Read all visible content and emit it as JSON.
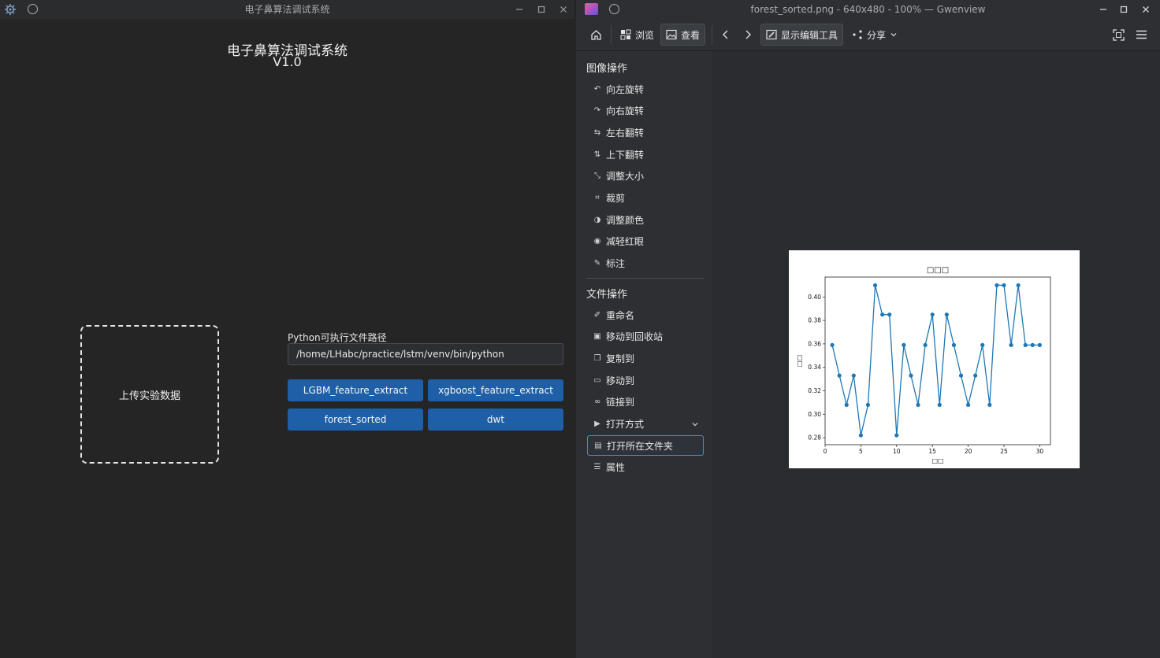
{
  "left_window": {
    "title": "电子鼻算法调试系统",
    "app_title": "电子鼻算法调试系统",
    "version": "V1.0",
    "upload_label": "上传实验数据",
    "python_path_label": "Python可执行文件路径",
    "python_path_value": "/home/LHabc/practice/lstm/venv/bin/python",
    "buttons": {
      "lgbm": "LGBM_feature_extract",
      "xgboost": "xgboost_feature_extract",
      "forest": "forest_sorted",
      "dwt": "dwt"
    }
  },
  "right_window": {
    "title": "forest_sorted.png - 640x480 - 100% — Gwenview",
    "toolbar": {
      "browse": "浏览",
      "view": "查看",
      "show_edit_tools": "显示编辑工具",
      "share": "分享"
    },
    "sidebar": {
      "image_ops_title": "图像操作",
      "image_ops": [
        {
          "label": "向左旋转",
          "icon": "rotate-left-icon"
        },
        {
          "label": "向右旋转",
          "icon": "rotate-right-icon"
        },
        {
          "label": "左右翻转",
          "icon": "flip-horizontal-icon"
        },
        {
          "label": "上下翻转",
          "icon": "flip-vertical-icon"
        },
        {
          "label": "调整大小",
          "icon": "resize-icon"
        },
        {
          "label": "裁剪",
          "icon": "crop-icon"
        },
        {
          "label": "调整颜色",
          "icon": "adjust-color-icon"
        },
        {
          "label": "减轻红眼",
          "icon": "red-eye-icon"
        },
        {
          "label": "标注",
          "icon": "annotate-icon"
        }
      ],
      "file_ops_title": "文件操作",
      "file_ops": [
        {
          "label": "重命名",
          "icon": "rename-icon"
        },
        {
          "label": "移动到回收站",
          "icon": "trash-icon"
        },
        {
          "label": "复制到",
          "icon": "copy-icon"
        },
        {
          "label": "移动到",
          "icon": "move-icon"
        },
        {
          "label": "链接到",
          "icon": "link-icon"
        },
        {
          "label": "打开方式",
          "icon": "open-with-icon"
        },
        {
          "label": "打开所在文件夹",
          "icon": "folder-icon"
        },
        {
          "label": "属性",
          "icon": "properties-icon"
        }
      ]
    }
  },
  "chart_data": {
    "type": "line",
    "title": "□□□",
    "xlabel": "□□",
    "ylabel": "□□",
    "x": [
      1,
      2,
      3,
      4,
      5,
      6,
      7,
      8,
      9,
      10,
      11,
      12,
      13,
      14,
      15,
      16,
      17,
      18,
      19,
      20,
      21,
      22,
      23,
      24,
      25,
      26,
      27,
      28,
      29,
      30
    ],
    "series": [
      {
        "values": [
          0.359,
          0.333,
          0.308,
          0.333,
          0.282,
          0.308,
          0.41,
          0.385,
          0.385,
          0.282,
          0.359,
          0.333,
          0.308,
          0.359,
          0.385,
          0.308,
          0.385,
          0.359,
          0.333,
          0.308,
          0.333,
          0.359,
          0.308,
          0.41,
          0.41,
          0.359,
          0.41,
          0.359,
          0.359,
          0.359
        ]
      }
    ],
    "xlim": [
      0,
      31.5
    ],
    "ylim": [
      0.274,
      0.417
    ],
    "xticks": [
      0,
      5,
      10,
      15,
      20,
      25,
      30
    ],
    "yticks": [
      0.28,
      0.3,
      0.32,
      0.34,
      0.36,
      0.38,
      0.4
    ],
    "ytick_labels": [
      "0.28",
      "0.30",
      "0.32",
      "0.34",
      "0.36",
      "0.38",
      "0.40"
    ],
    "color": "#1f77b4",
    "grid": false,
    "legend": false
  }
}
